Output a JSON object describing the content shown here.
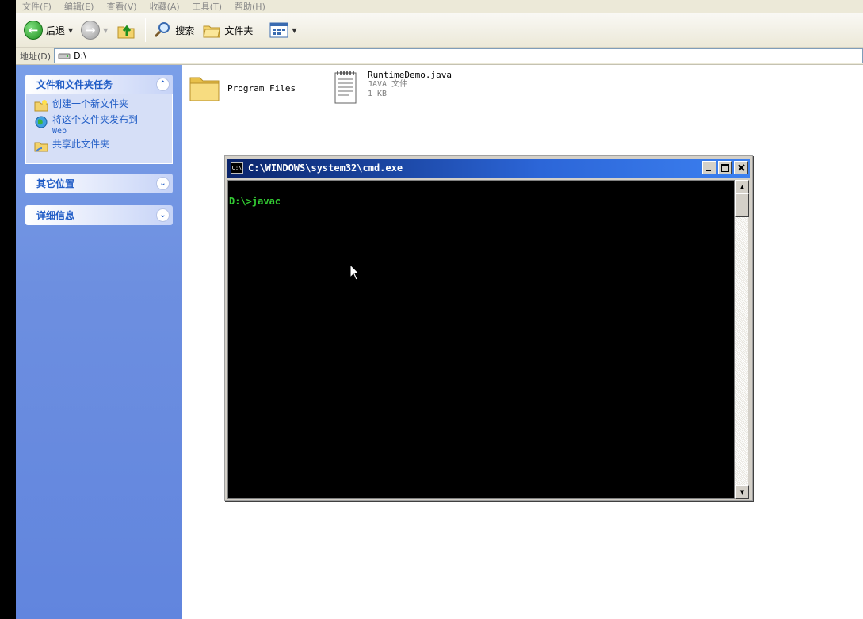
{
  "menu": [
    "文件(F)",
    "编辑(E)",
    "查看(V)",
    "收藏(A)",
    "工具(T)",
    "帮助(H)"
  ],
  "toolbar": {
    "back_label": "后退",
    "search_label": "搜索",
    "folders_label": "文件夹"
  },
  "address": {
    "label": "地址(D)",
    "value": "D:\\"
  },
  "taskpane": {
    "tasks_title": "文件和文件夹任务",
    "tasks": [
      "创建一个新文件夹",
      "将这个文件夹发布到",
      "Web",
      "共享此文件夹"
    ],
    "other_places_title": "其它位置",
    "details_title": "详细信息"
  },
  "files": {
    "folder_name": "Program Files",
    "file_name": "RuntimeDemo.java",
    "file_type": "JAVA 文件",
    "file_size": "1 KB"
  },
  "cmd": {
    "title": "C:\\WINDOWS\\system32\\cmd.exe",
    "icon_text": "C:\\",
    "line": "D:\\>javac"
  },
  "colors": {
    "taskpane_blue": "#6d8fe0",
    "title_blue": "#0a246a",
    "console_green": "#33cc33",
    "link_blue": "#215dc6"
  }
}
